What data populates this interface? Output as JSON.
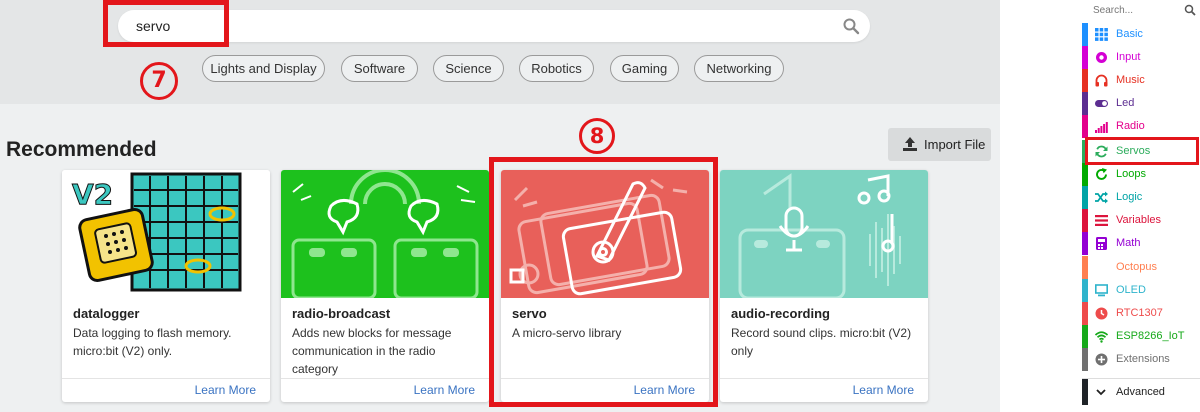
{
  "search": {
    "value": "servo"
  },
  "categories": [
    "Lights and Display",
    "Software",
    "Science",
    "Robotics",
    "Gaming",
    "Networking"
  ],
  "annotations": {
    "step7": "7",
    "step8": "8"
  },
  "section": {
    "title": "Recommended"
  },
  "import_button": {
    "label": "Import File"
  },
  "cards": [
    {
      "title": "datalogger",
      "description": "Data logging to flash memory. micro:bit (V2) only.",
      "image_text": "V2",
      "link": "Learn More"
    },
    {
      "title": "radio-broadcast",
      "description": "Adds new blocks for message communication in the radio category",
      "link": "Learn More"
    },
    {
      "title": "servo",
      "description": "A micro-servo library",
      "link": "Learn More"
    },
    {
      "title": "audio-recording",
      "description": "Record sound clips. micro:bit (V2) only",
      "link": "Learn More"
    }
  ],
  "toolbox": {
    "search_placeholder": "Search...",
    "items": [
      {
        "label": "Basic",
        "color": "#1e90ff",
        "icon": "grid-icon"
      },
      {
        "label": "Input",
        "color": "#d400d4",
        "icon": "radio-target-icon"
      },
      {
        "label": "Music",
        "color": "#e63022",
        "icon": "headphones-icon"
      },
      {
        "label": "Led",
        "color": "#5c2d91",
        "icon": "toggle-icon"
      },
      {
        "label": "Radio",
        "color": "#e3008c",
        "icon": "signal-bars-icon"
      },
      {
        "label": "Servos",
        "color": "#2bac5b",
        "icon": "sync-arrows-icon"
      },
      {
        "label": "Loops",
        "color": "#00aa00",
        "icon": "refresh-icon"
      },
      {
        "label": "Logic",
        "color": "#00a4a6",
        "icon": "shuffle-icon"
      },
      {
        "label": "Variables",
        "color": "#dc143c",
        "icon": "list-icon"
      },
      {
        "label": "Math",
        "color": "#9400d3",
        "icon": "calculator-icon"
      },
      {
        "label": "Octopus",
        "color": "#ff7f50",
        "icon": ""
      },
      {
        "label": "OLED",
        "color": "#2fb4cc",
        "icon": "monitor-icon"
      },
      {
        "label": "RTC1307",
        "color": "#ee4b4b",
        "icon": "clock-icon"
      },
      {
        "label": "ESP8266_IoT",
        "color": "#16a91a",
        "icon": "wifi-icon"
      },
      {
        "label": "Extensions",
        "color": "#707070",
        "icon": "plus-circle-icon"
      }
    ],
    "advanced_label": "Advanced"
  }
}
